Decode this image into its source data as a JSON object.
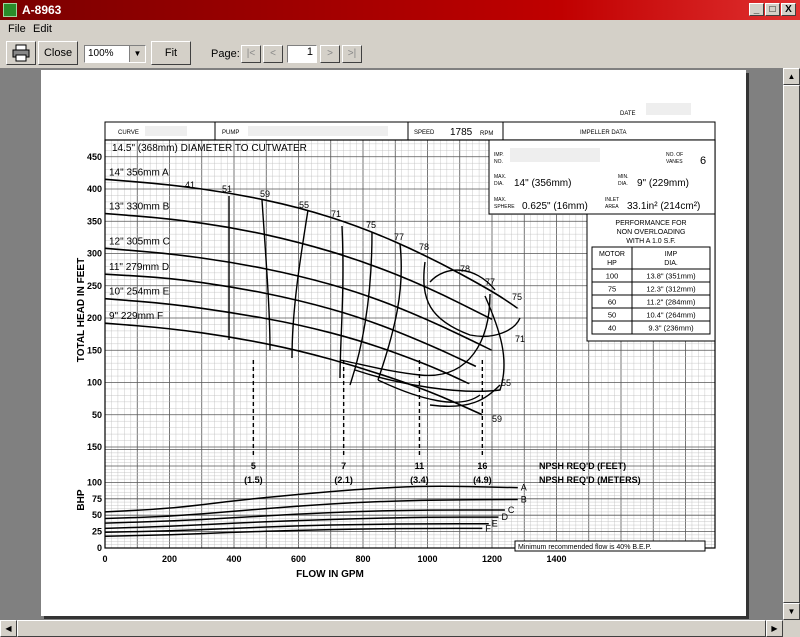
{
  "window": {
    "title": "A-8963",
    "min": "_",
    "max": "□",
    "close": "X"
  },
  "menu": {
    "file": "File",
    "edit": "Edit"
  },
  "toolbar": {
    "close_label": "Close",
    "zoom_value": "100%",
    "fit_label": "Fit",
    "page_label": "Page:",
    "page_value": "1",
    "first": "|<",
    "prev": "<",
    "next": ">",
    "last": ">|"
  },
  "doc": {
    "date_label": "DATE",
    "curve_label": "CURVE",
    "pump_label": "PUMP",
    "speed_label": "SPEED",
    "speed_value": "1785",
    "rpm_label": "RPM",
    "impeller_label": "IMPELLER DATA",
    "cutwater_label": "14.5\" (368mm) DIAMETER TO CUTWATER",
    "imp_no_label": [
      "IMP.",
      "NO."
    ],
    "vanes_label": [
      "NO. OF",
      "VANES"
    ],
    "vanes_value": "6",
    "max_dia_label": [
      "MAX.",
      "DIA."
    ],
    "max_dia_value": "14\" (356mm)",
    "min_dia_label": [
      "MIN.",
      "DIA."
    ],
    "min_dia_value": "9\" (229mm)",
    "max_sphere_label": [
      "MAX.",
      "SPHERE"
    ],
    "max_sphere_value": "0.625\" (16mm)",
    "inlet_area_label": [
      "INLET",
      "AREA"
    ],
    "inlet_area_value": "33.1in² (214cm²)",
    "perf_title": [
      "PERFORMANCE FOR",
      "NON OVERLOADING",
      "WITH A 1.0 S.F."
    ],
    "perf_headers": [
      [
        "MOTOR",
        "HP"
      ],
      [
        "IMP",
        "DIA."
      ]
    ],
    "perf_rows": [
      [
        "100",
        "13.8\" (351mm)"
      ],
      [
        "75",
        "12.3\" (312mm)"
      ],
      [
        "60",
        "11.2\" (284mm)"
      ],
      [
        "50",
        "10.4\" (264mm)"
      ],
      [
        "40",
        "9.3\" (236mm)"
      ]
    ],
    "y_label_head": "TOTAL HEAD IN FEET",
    "y_label_bhp": "BHP",
    "x_label": "FLOW IN GPM",
    "npsh_feet_label": "NPSH REQ'D (FEET)",
    "npsh_meters_label": "NPSH REQ'D (METERS)",
    "min_flow_note": "Minimum recommended flow is 40% B.E.P."
  },
  "chart_data": {
    "type": "line",
    "title": "",
    "xlabel": "FLOW IN GPM",
    "ylabel": "TOTAL HEAD IN FEET",
    "xlim": [
      0,
      1400
    ],
    "ylim": [
      0,
      450
    ],
    "x_ticks": [
      "0",
      "200",
      "400",
      "600",
      "800",
      "1000",
      "1200",
      "1400"
    ],
    "y_ticks": [
      "50",
      "100",
      "150",
      "200",
      "250",
      "300",
      "350",
      "400",
      "450"
    ],
    "bhp_ticks": [
      "0",
      "25",
      "50",
      "75",
      "100",
      "150"
    ],
    "series": [
      {
        "name": "14\" 356mm A",
        "x": [
          0,
          200,
          400,
          600,
          800,
          1000,
          1200,
          1280
        ],
        "y": [
          415,
          407,
          393,
          372,
          340,
          296,
          242,
          215
        ]
      },
      {
        "name": "13\" 330mm B",
        "x": [
          0,
          200,
          400,
          600,
          800,
          1000,
          1200
        ],
        "y": [
          362,
          354,
          340,
          318,
          288,
          248,
          198
        ]
      },
      {
        "name": "12\" 305mm C",
        "x": [
          0,
          200,
          400,
          600,
          800,
          1000,
          1200
        ],
        "y": [
          308,
          300,
          286,
          266,
          238,
          198,
          150
        ]
      },
      {
        "name": "11\" 279mm D",
        "x": [
          0,
          200,
          400,
          600,
          800,
          1000,
          1150
        ],
        "y": [
          268,
          262,
          248,
          228,
          200,
          160,
          125
        ]
      },
      {
        "name": "10\" 254mm E",
        "x": [
          0,
          200,
          400,
          600,
          800,
          1000,
          1130
        ],
        "y": [
          230,
          222,
          208,
          190,
          164,
          128,
          98
        ]
      },
      {
        "name": "9\" 229mm F",
        "x": [
          0,
          200,
          400,
          600,
          800,
          1000,
          1170
        ],
        "y": [
          192,
          184,
          170,
          150,
          122,
          88,
          50
        ]
      }
    ],
    "efficiency_labels": [
      "41",
      "51",
      "59",
      "55",
      "71",
      "75",
      "77",
      "78",
      "78",
      "77",
      "75",
      "71",
      "55",
      "59"
    ],
    "npsh": [
      {
        "flow": 460,
        "feet": "5",
        "meters": "(1.5)"
      },
      {
        "flow": 740,
        "feet": "7",
        "meters": "(2.1)"
      },
      {
        "flow": 975,
        "feet": "11",
        "meters": "(3.4)"
      },
      {
        "flow": 1170,
        "feet": "16",
        "meters": "(4.9)"
      }
    ],
    "bhp_series": [
      {
        "name": "A",
        "x": [
          0,
          200,
          400,
          600,
          800,
          1000,
          1280
        ],
        "y": [
          55,
          60,
          72,
          82,
          90,
          95,
          92
        ]
      },
      {
        "name": "B",
        "x": [
          0,
          200,
          400,
          600,
          800,
          1000,
          1280
        ],
        "y": [
          45,
          48,
          56,
          64,
          70,
          73,
          74
        ]
      },
      {
        "name": "C",
        "x": [
          0,
          200,
          400,
          600,
          800,
          1000,
          1240
        ],
        "y": [
          38,
          41,
          46,
          52,
          56,
          58,
          58
        ]
      },
      {
        "name": "D",
        "x": [
          0,
          200,
          400,
          600,
          800,
          1000,
          1220
        ],
        "y": [
          30,
          33,
          38,
          42,
          45,
          47,
          47
        ]
      },
      {
        "name": "E",
        "x": [
          0,
          200,
          400,
          600,
          800,
          1000,
          1190
        ],
        "y": [
          24,
          26,
          30,
          34,
          36,
          37,
          37
        ]
      },
      {
        "name": "F",
        "x": [
          0,
          200,
          400,
          600,
          800,
          1000,
          1170
        ],
        "y": [
          18,
          20,
          24,
          27,
          29,
          30,
          30
        ]
      }
    ]
  }
}
